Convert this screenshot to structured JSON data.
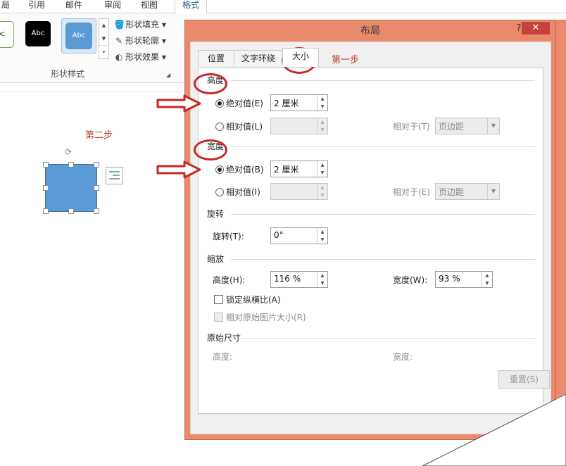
{
  "ribbon": {
    "tabs": [
      "局",
      "引用",
      "邮件",
      "审阅",
      "视图",
      "格式"
    ],
    "style_swatches": [
      "bc",
      "Abc",
      "Abc"
    ],
    "shape_fill": "形状填充",
    "shape_outline": "形状轮廓",
    "shape_effects": "形状效果",
    "group_label": "形状样式"
  },
  "canvas": {
    "step2_label": "第二步"
  },
  "dialog": {
    "title": "布局",
    "help": "?",
    "close": "✕",
    "tabs": [
      "位置",
      "文字环绕",
      "大小"
    ],
    "active_tab": "大小",
    "step1_label": "第一步",
    "height": {
      "title": "高度",
      "absolute_label": "绝对值(E)",
      "absolute_value": "2 厘米",
      "relative_label": "相对值(L)",
      "relative_to_label": "相对于(T)",
      "relative_to_value": "页边距"
    },
    "width": {
      "title": "宽度",
      "absolute_label": "绝对值(B)",
      "absolute_value": "2 厘米",
      "relative_label": "相对值(I)",
      "relative_to_label": "相对于(E)",
      "relative_to_value": "页边距"
    },
    "rotation": {
      "title": "旋转",
      "label": "旋转(T):",
      "value": "0°"
    },
    "scale": {
      "title": "缩放",
      "height_label": "高度(H):",
      "height_value": "116 %",
      "width_label": "宽度(W):",
      "width_value": "93 %",
      "lock_aspect": "锁定纵横比(A)",
      "relative_original": "相对原始图片大小(R)"
    },
    "original_size": {
      "title": "原始尺寸",
      "height_label": "高度:",
      "width_label": "宽度:"
    },
    "reset": "重置(S)"
  },
  "colors": {
    "dialog_frame": "#e98a6d",
    "annotation_red": "#c62828",
    "shape_fill": "#5b9bd5",
    "close_button": "#c7423a"
  }
}
